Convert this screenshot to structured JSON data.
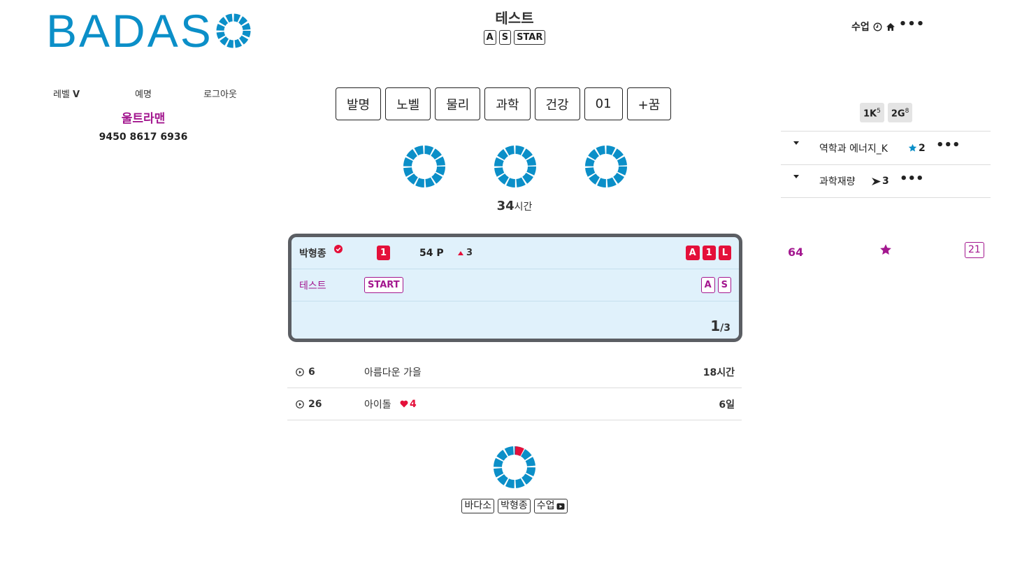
{
  "brand": {
    "logo_text": "BADAS",
    "logo_letter_o": "O",
    "accent": "#0b8fc8",
    "magenta": "#a3178f",
    "red": "#e4103a"
  },
  "header": {
    "title": "테스트",
    "badges": [
      "A",
      "S",
      "STAR"
    ],
    "right": {
      "label": "수업",
      "clock_icon": "clock-icon",
      "home_icon": "home-icon",
      "more_icon": "more-icon"
    }
  },
  "user": {
    "menu": {
      "level_label": "레벨",
      "level_value": "V",
      "honor": "예명",
      "logout": "로그아웃"
    },
    "name": "울트라맨",
    "number": "9450 8617 6936"
  },
  "categories": [
    "발명",
    "노벨",
    "물리",
    "과학",
    "건강",
    "01",
    "+꿈"
  ],
  "hours": {
    "value": "34",
    "unit": "시간"
  },
  "card": {
    "row1": {
      "name": "박형종",
      "rank": "1",
      "points": "54 P",
      "delta": "3",
      "tags": [
        "A",
        "1",
        "L"
      ]
    },
    "row2": {
      "label": "테스트",
      "status": "START",
      "tags": [
        "A",
        "S"
      ]
    },
    "pager": {
      "current": "1",
      "total": "/3"
    }
  },
  "list": [
    {
      "count": "6",
      "title": "아름다운 가을",
      "likes": "",
      "time": "18시간"
    },
    {
      "count": "26",
      "title": "아이돌",
      "likes": "4",
      "time": "6일"
    }
  ],
  "right_panel": {
    "badges": [
      {
        "base": "1K",
        "exp": "5"
      },
      {
        "base": "2G",
        "exp": "8"
      }
    ],
    "rows": [
      {
        "title": "역학과 에너지_K",
        "icon": "star-icon",
        "value": "2"
      },
      {
        "title": "과학재량",
        "icon": "arrow-right-icon",
        "value": "3"
      }
    ],
    "stats": {
      "left": "64",
      "right": "21"
    }
  },
  "footer": {
    "buttons": [
      "바다소",
      "박형종",
      "수업"
    ],
    "play_icon": "play-icon"
  }
}
